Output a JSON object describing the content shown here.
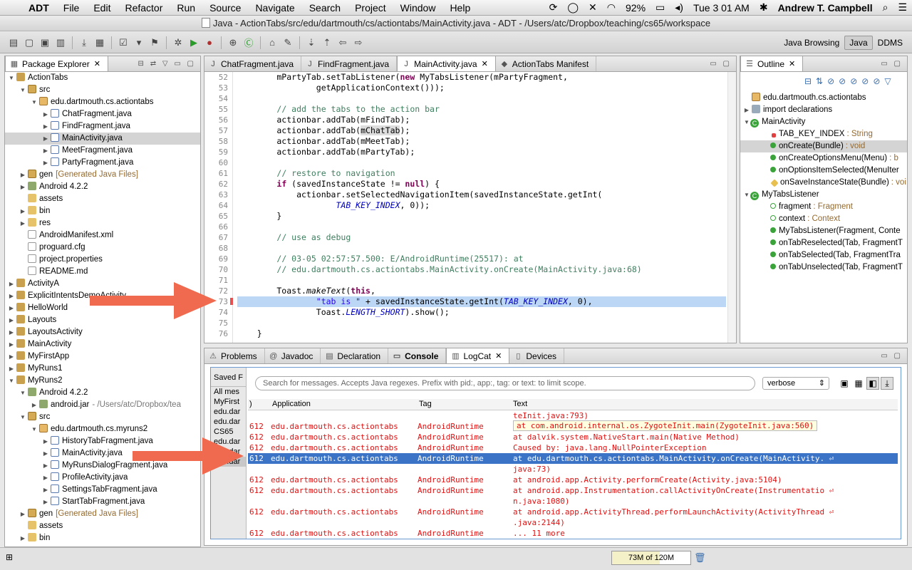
{
  "menubar": {
    "app": "ADT",
    "items": [
      "File",
      "Edit",
      "Refactor",
      "Run",
      "Source",
      "Navigate",
      "Search",
      "Project",
      "Window",
      "Help"
    ],
    "battery": "92%",
    "clock": "Tue 3 01 AM",
    "user": "Andrew T. Campbell"
  },
  "window": {
    "title": "Java - ActionTabs/src/edu/dartmouth/cs/actiontabs/MainActivity.java - ADT - /Users/atc/Dropbox/teaching/cs65/workspace"
  },
  "perspectives": [
    "Java Browsing",
    "Java",
    "DDMS"
  ],
  "package_explorer": {
    "tab": "Package Explorer",
    "rows": [
      {
        "label": "ActionTabs",
        "note": ""
      },
      {
        "label": "src",
        "note": ""
      },
      {
        "label": "edu.dartmouth.cs.actiontabs",
        "note": ""
      },
      {
        "label": "ChatFragment.java",
        "note": ""
      },
      {
        "label": "FindFragment.java",
        "note": ""
      },
      {
        "label": "MainActivity.java",
        "note": ""
      },
      {
        "label": "MeetFragment.java",
        "note": ""
      },
      {
        "label": "PartyFragment.java",
        "note": ""
      },
      {
        "label": "gen",
        "note": "[Generated Java Files]"
      },
      {
        "label": "Android 4.2.2",
        "note": ""
      },
      {
        "label": "assets",
        "note": ""
      },
      {
        "label": "bin",
        "note": ""
      },
      {
        "label": "res",
        "note": ""
      },
      {
        "label": "AndroidManifest.xml",
        "note": ""
      },
      {
        "label": "proguard.cfg",
        "note": ""
      },
      {
        "label": "project.properties",
        "note": ""
      },
      {
        "label": "README.md",
        "note": ""
      },
      {
        "label": "ActivityA",
        "note": ""
      },
      {
        "label": "ExplicitIntentsDemoActivity",
        "note": ""
      },
      {
        "label": "HelloWorld",
        "note": ""
      },
      {
        "label": "Layouts",
        "note": ""
      },
      {
        "label": "LayoutsActivity",
        "note": ""
      },
      {
        "label": "MainActivity",
        "note": ""
      },
      {
        "label": "MyFirstApp",
        "note": ""
      },
      {
        "label": "MyRuns1",
        "note": ""
      },
      {
        "label": "MyRuns2",
        "note": ""
      },
      {
        "label": "Android 4.2.2",
        "note": ""
      },
      {
        "label": "android.jar",
        "note": "- /Users/atc/Dropbox/tea"
      },
      {
        "label": "src",
        "note": ""
      },
      {
        "label": "edu.dartmouth.cs.myruns2",
        "note": ""
      },
      {
        "label": "HistoryTabFragment.java",
        "note": ""
      },
      {
        "label": "MainActivity.java",
        "note": ""
      },
      {
        "label": "MyRunsDialogFragment.java",
        "note": ""
      },
      {
        "label": "ProfileActivity.java",
        "note": ""
      },
      {
        "label": "SettingsTabFragment.java",
        "note": ""
      },
      {
        "label": "StartTabFragment.java",
        "note": ""
      },
      {
        "label": "gen",
        "note": "[Generated Java Files]"
      },
      {
        "label": "assets",
        "note": ""
      },
      {
        "label": "bin",
        "note": ""
      }
    ]
  },
  "editor": {
    "tabs": [
      "ChatFragment.java",
      "FindFragment.java",
      "MainActivity.java",
      "ActionTabs Manifest"
    ],
    "line_numbers": [
      "52",
      "53",
      "54",
      "55",
      "56",
      "57",
      "58",
      "59",
      "60",
      "61",
      "62",
      "63",
      "64",
      "65",
      "66",
      "67",
      "68",
      "69",
      "70",
      "71",
      "72",
      "73",
      "74",
      "75",
      "76"
    ]
  },
  "outline": {
    "tab": "Outline",
    "rows": [
      {
        "label": "edu.dartmouth.cs.actiontabs",
        "type": ""
      },
      {
        "label": "import declarations",
        "type": ""
      },
      {
        "label": "MainActivity",
        "type": ""
      },
      {
        "label": "TAB_KEY_INDEX",
        "type": ": String"
      },
      {
        "label": "onCreate(Bundle)",
        "type": ": void"
      },
      {
        "label": "onCreateOptionsMenu(Menu)",
        "type": ": b"
      },
      {
        "label": "onOptionsItemSelected(MenuIter",
        "type": ""
      },
      {
        "label": "onSaveInstanceState(Bundle)",
        "type": ": voi"
      },
      {
        "label": "MyTabsListener",
        "type": ""
      },
      {
        "label": "fragment",
        "type": ": Fragment"
      },
      {
        "label": "context",
        "type": ": Context"
      },
      {
        "label": "MyTabsListener(Fragment, Conte",
        "type": ""
      },
      {
        "label": "onTabReselected(Tab, FragmentT",
        "type": ""
      },
      {
        "label": "onTabSelected(Tab, FragmentTra",
        "type": ""
      },
      {
        "label": "onTabUnselected(Tab, FragmentT",
        "type": ""
      }
    ]
  },
  "bottom": {
    "tabs": [
      "Problems",
      "Javadoc",
      "Declaration",
      "Console",
      "LogCat",
      "Devices"
    ],
    "saved_filters": [
      "Saved F",
      "All mes",
      "MyFirst",
      "edu.dar",
      "edu.dar",
      "CS65",
      "edu.dar",
      "edu.dar",
      "edu.dar"
    ],
    "search_placeholder": "Search for messages. Accepts Java regexes. Prefix with pid:, app:, tag: or text: to limit scope.",
    "level": "verbose",
    "headers": {
      "pid": ")",
      "app": "Application",
      "tag": "Tag",
      "text": "Text"
    },
    "tooltip": "at com.android.internal.os.ZygoteInit.main(ZygoteInit.java:560)",
    "rows": [
      {
        "pid": "",
        "app": "",
        "tag": "",
        "text": "teInit.java:793)"
      },
      {
        "pid": "612",
        "app": "edu.dartmouth.cs.actiontabs",
        "tag": "AndroidRuntime",
        "text": ""
      },
      {
        "pid": "612",
        "app": "edu.dartmouth.cs.actiontabs",
        "tag": "AndroidRuntime",
        "text": "    at dalvik.system.NativeStart.main(Native Method)"
      },
      {
        "pid": "612",
        "app": "edu.dartmouth.cs.actiontabs",
        "tag": "AndroidRuntime",
        "text": "Caused by: java.lang.NullPointerException"
      },
      {
        "pid": "612",
        "app": "edu.dartmouth.cs.actiontabs",
        "tag": "AndroidRuntime",
        "text": "    at edu.dartmouth.cs.actiontabs.MainActivity.onCreate(MainActivity. ⏎"
      },
      {
        "pid": "",
        "app": "",
        "tag": "",
        "text": "java:73)"
      },
      {
        "pid": "612",
        "app": "edu.dartmouth.cs.actiontabs",
        "tag": "AndroidRuntime",
        "text": "    at android.app.Activity.performCreate(Activity.java:5104)"
      },
      {
        "pid": "612",
        "app": "edu.dartmouth.cs.actiontabs",
        "tag": "AndroidRuntime",
        "text": "    at android.app.Instrumentation.callActivityOnCreate(Instrumentatio ⏎"
      },
      {
        "pid": "",
        "app": "",
        "tag": "",
        "text": "n.java:1080)"
      },
      {
        "pid": "612",
        "app": "edu.dartmouth.cs.actiontabs",
        "tag": "AndroidRuntime",
        "text": "    at android.app.ActivityThread.performLaunchActivity(ActivityThread ⏎"
      },
      {
        "pid": "",
        "app": "",
        "tag": "",
        "text": ".java:2144)"
      },
      {
        "pid": "612",
        "app": "edu.dartmouth.cs.actiontabs",
        "tag": "AndroidRuntime",
        "text": "    ... 11 more"
      }
    ]
  },
  "status": {
    "heap": "73M of 120M",
    "heap_used_fraction": 0.61
  },
  "colors": {
    "arrow": "#ef6a4e",
    "selection": "#3b73c6",
    "editor_highlight": "#bcd6f5",
    "log_error": "#e01010"
  }
}
